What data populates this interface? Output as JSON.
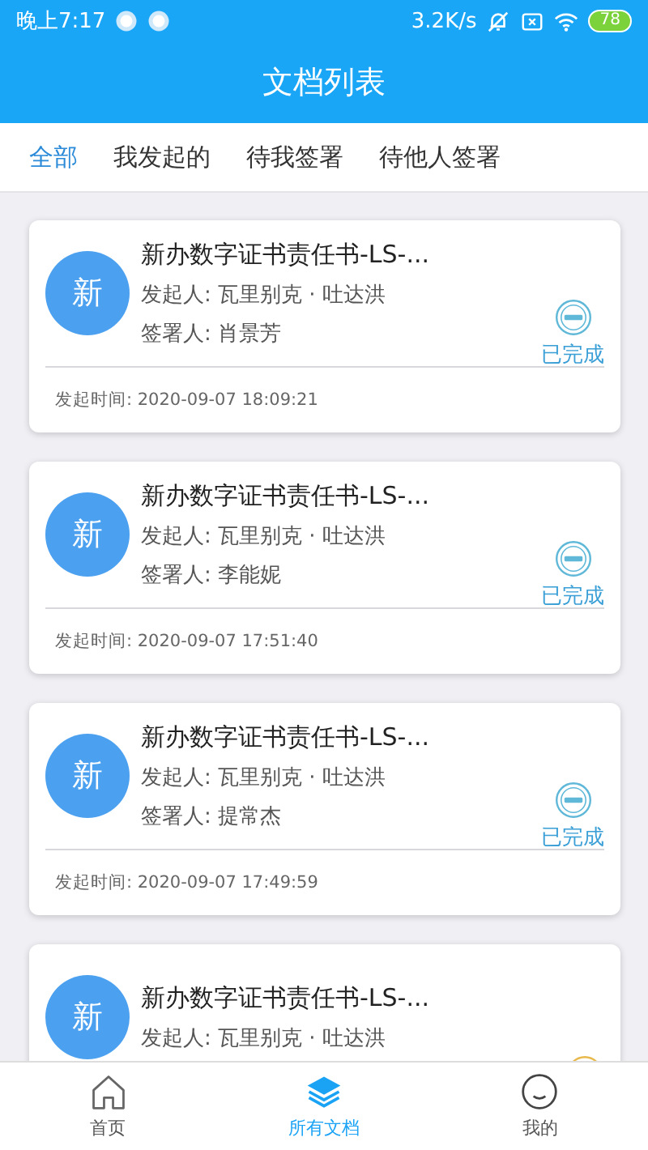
{
  "status_bar": {
    "time": "晚上7:17",
    "speed": "3.2K/s",
    "battery": "78"
  },
  "header": {
    "title": "文档列表"
  },
  "tabs": [
    {
      "label": "全部",
      "selected": true
    },
    {
      "label": "我发起的",
      "selected": false
    },
    {
      "label": "待我签署",
      "selected": false
    },
    {
      "label": "待他人签署",
      "selected": false
    }
  ],
  "documents": [
    {
      "avatar": "新",
      "title": "新办数字证书责任书-LS-...",
      "initiator": "发起人: 瓦里别克 · 吐达洪",
      "signer": "签署人: 肖景芳",
      "status": "已完成",
      "kind": "done",
      "time": "发起时间: 2020-09-07 18:09:21"
    },
    {
      "avatar": "新",
      "title": "新办数字证书责任书-LS-...",
      "initiator": "发起人: 瓦里别克 · 吐达洪",
      "signer": "签署人: 李能妮",
      "status": "已完成",
      "kind": "done",
      "time": "发起时间: 2020-09-07 17:51:40"
    },
    {
      "avatar": "新",
      "title": "新办数字证书责任书-LS-...",
      "initiator": "发起人: 瓦里别克 · 吐达洪",
      "signer": "签署人: 提常杰",
      "status": "已完成",
      "kind": "done",
      "time": "发起时间: 2020-09-07 17:49:59"
    },
    {
      "avatar": "新",
      "title": "新办数字证书责任书-LS-...",
      "initiator": "发起人: 瓦里别克 · 吐达洪",
      "kind": "pending"
    }
  ],
  "bottom_nav": [
    {
      "label": "首页",
      "kind": "home",
      "selected": false
    },
    {
      "label": "所有文档",
      "kind": "layers",
      "selected": true
    },
    {
      "label": "我的",
      "kind": "face",
      "selected": false
    }
  ]
}
